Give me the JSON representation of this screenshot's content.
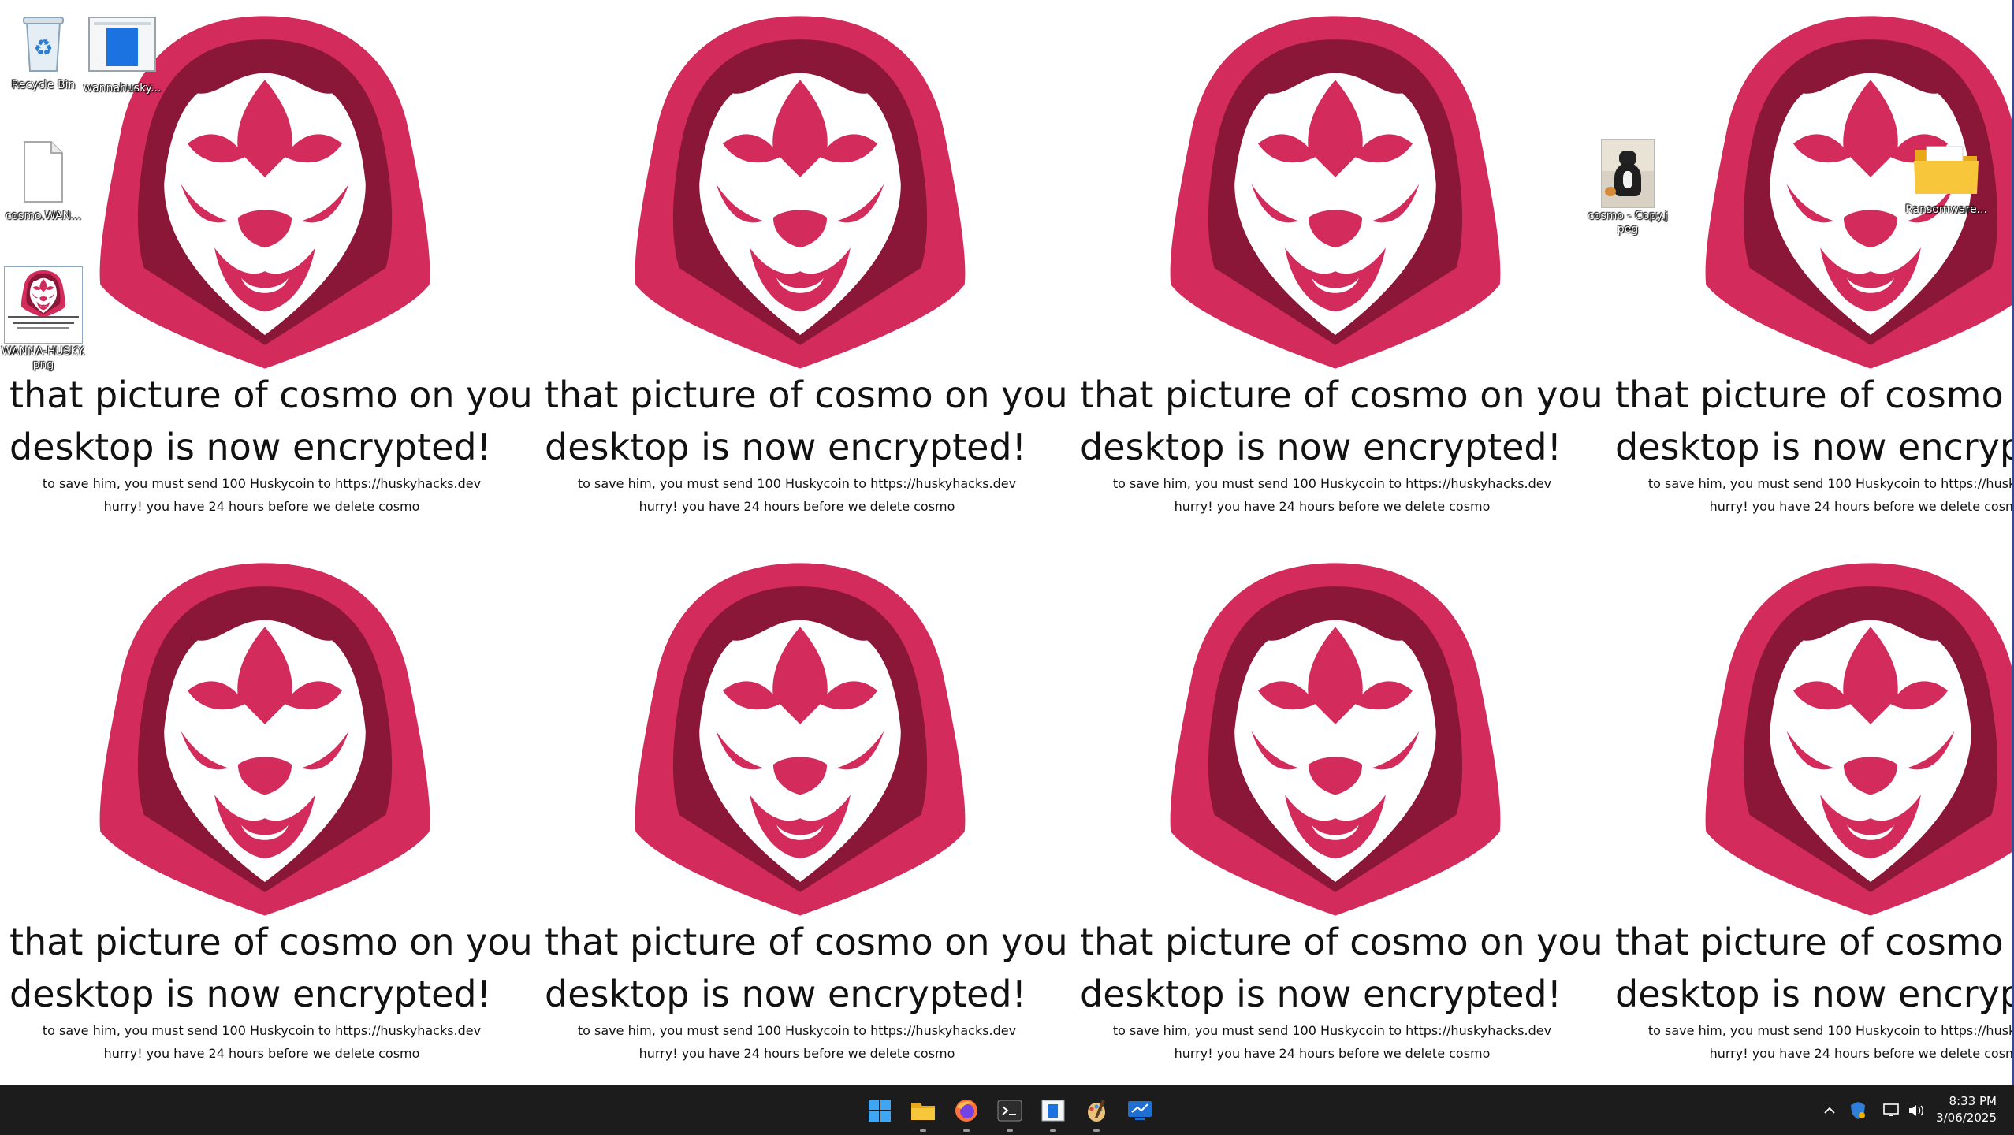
{
  "desktop": {
    "ransom_note": {
      "line1": "that picture of cosmo on your",
      "line2": "desktop is now encrypted!",
      "sub1": "to save him, you must send 100 Huskycoin to https://huskyhacks.dev",
      "sub2": "hurry! you have 24 hours before we delete cosmo"
    },
    "icons": [
      {
        "name": "recycle-bin",
        "label": "Recycle Bin"
      },
      {
        "name": "wannahusky-exe",
        "label": "wannahusky..."
      },
      {
        "name": "cosmo-wannahusky-file",
        "label": "cosmo.WAN..."
      },
      {
        "name": "wannahusky-png",
        "label": "WANNA-HUSKY.png"
      },
      {
        "name": "cosmo-copy-jpeg",
        "label": "cosmo - Copy.jpeg"
      },
      {
        "name": "ransomware-folder",
        "label": "Ransomware..."
      }
    ]
  },
  "taskbar": {
    "apps": [
      "start",
      "file-explorer",
      "firefox",
      "terminal",
      "wannahusky",
      "paint",
      "remote-desktop"
    ],
    "clock": {
      "time": "8:33 PM",
      "date": "3/06/2025"
    }
  },
  "colors": {
    "hood_dark": "#8a1738",
    "hood_main": "#d22b5c",
    "taskbar": "#1c1c1c",
    "accent": "#3b8fe8"
  }
}
